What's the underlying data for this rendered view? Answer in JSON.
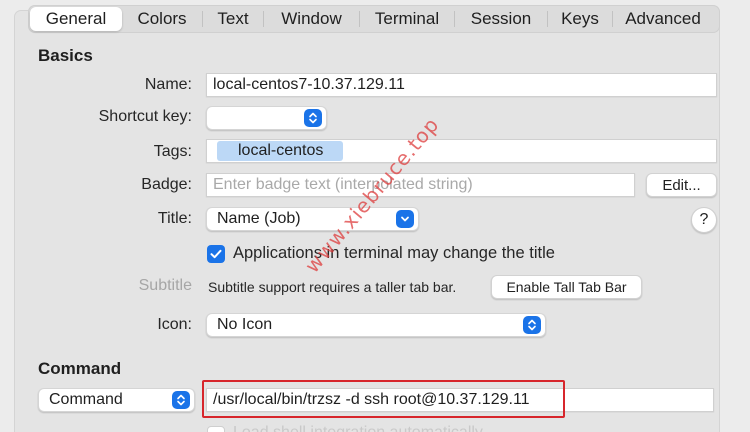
{
  "tabs": [
    {
      "label": "General",
      "active": true
    },
    {
      "label": "Colors"
    },
    {
      "label": "Text"
    },
    {
      "label": "Window"
    },
    {
      "label": "Terminal"
    },
    {
      "label": "Session"
    },
    {
      "label": "Keys"
    },
    {
      "label": "Advanced"
    }
  ],
  "basics": {
    "title": "Basics",
    "name_label": "Name:",
    "name_value": "local-centos7-10.37.129.11",
    "shortcut_label": "Shortcut key:",
    "shortcut_value": "",
    "tags_label": "Tags:",
    "tag_chip": "local-centos",
    "badge_label": "Badge:",
    "badge_placeholder": "Enter badge text (interpolated string)",
    "edit_button": "Edit...",
    "title_label": "Title:",
    "title_value": "Name (Job)",
    "help_button": "?",
    "apps_change_title_label": "Applications in terminal may change the title",
    "apps_change_title_checked": true,
    "subtitle_label": "Subtitle",
    "subtitle_note": "Subtitle support requires a taller tab bar.",
    "enable_tall_tab_bar_button": "Enable Tall Tab Bar",
    "icon_label": "Icon:",
    "icon_value": "No Icon"
  },
  "command": {
    "title": "Command",
    "type_value": "Command",
    "command_value": "/usr/local/bin/trzsz -d ssh root@10.37.129.11",
    "cut_off_option": "Load shell integration automatically"
  },
  "watermark": "www.xiebruce.top",
  "colors": {
    "accent": "#1a73e8",
    "tag_chip": "#bcd8f6",
    "highlight": "#d7262c",
    "watermark": "#de3c3c"
  }
}
